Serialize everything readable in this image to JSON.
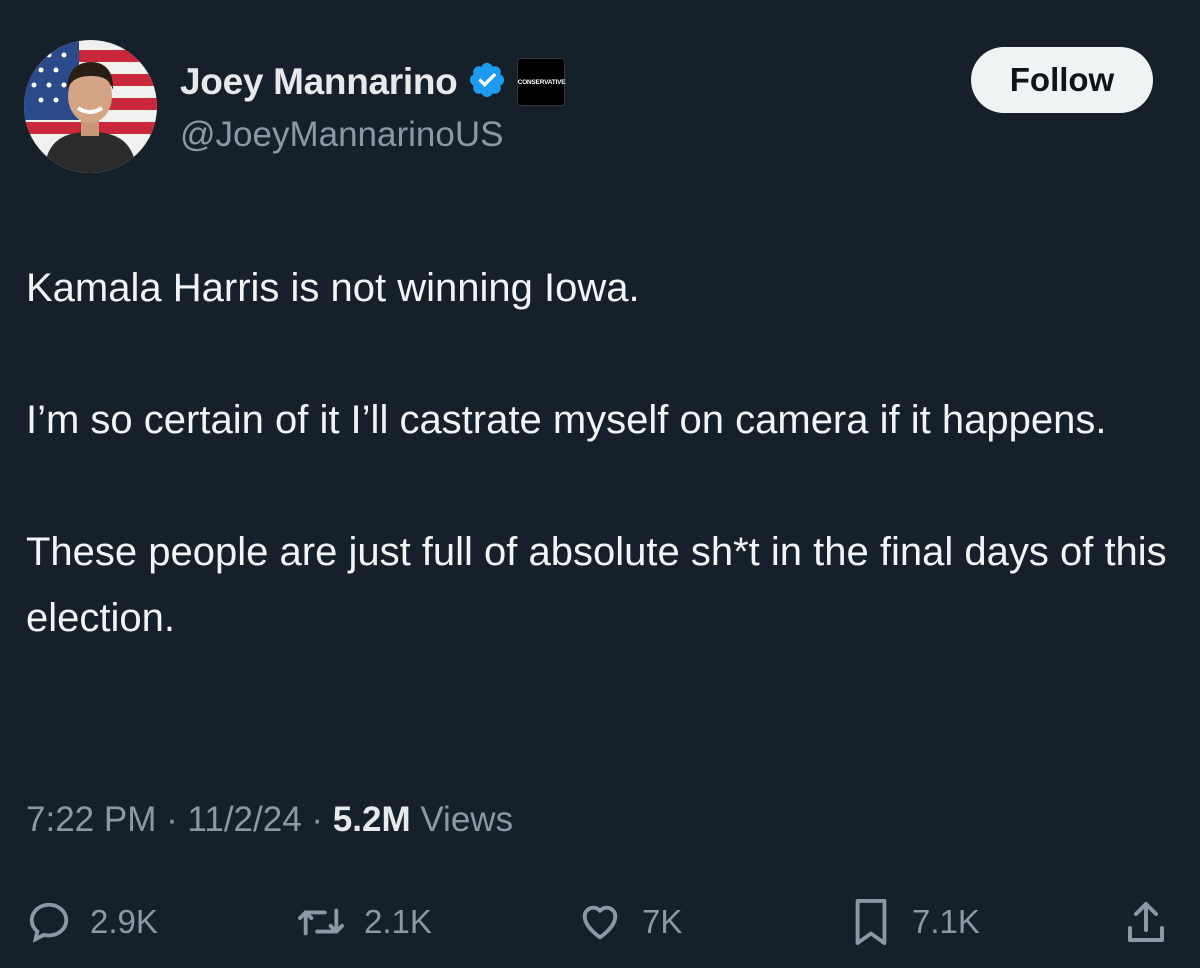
{
  "author": {
    "display_name": "Joey Mannarino",
    "handle": "@JoeyMannarinoUS",
    "affiliate_badge": "CONSERVATIVE",
    "verified_color": "#1d9bf0"
  },
  "follow_button": {
    "label": "Follow"
  },
  "tweet": {
    "paragraphs": [
      "Kamala Harris is not winning Iowa.",
      "I’m so certain of it I’ll castrate myself on camera if it happens.",
      "These people are just full of absolute sh*t in the final days of this election."
    ],
    "time": "7:22 PM",
    "date": "11/2/24",
    "separator": "·",
    "views_count": "5.2M",
    "views_label": "Views"
  },
  "actions": {
    "replies": {
      "icon": "reply-icon",
      "count": "2.9K"
    },
    "reposts": {
      "icon": "repost-icon",
      "count": "2.1K"
    },
    "likes": {
      "icon": "heart-icon",
      "count": "7K"
    },
    "bookmarks": {
      "icon": "bookmark-icon",
      "count": "7.1K"
    },
    "share": {
      "icon": "share-icon"
    }
  },
  "colors": {
    "background": "#15202b",
    "text": "#e7e9ea",
    "secondary": "#8b98a5",
    "button_bg": "#eff3f4"
  }
}
